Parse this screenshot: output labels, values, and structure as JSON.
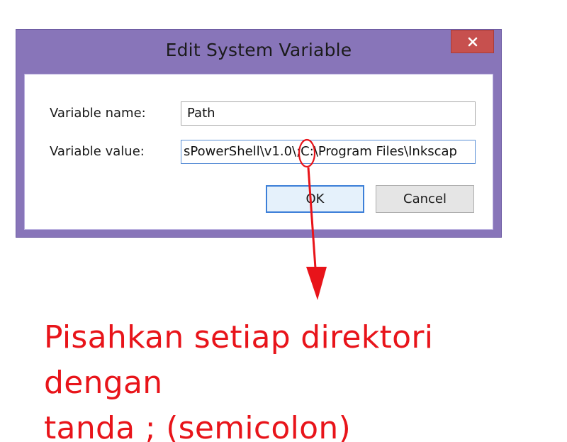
{
  "dialog": {
    "title": "Edit System Variable",
    "variable_name_label": "Variable name:",
    "variable_value_label": "Variable value:",
    "variable_name_value": "Path",
    "variable_value_value": "sPowerShell\\v1.0\\;C:\\Program Files\\Inkscap",
    "ok_label": "OK",
    "cancel_label": "Cancel",
    "close_icon": "close-icon"
  },
  "annotation": {
    "line1": "Pisahkan setiap direktori dengan",
    "line2": "tanda ; (semicolon)",
    "color": "#e8141a"
  },
  "colors": {
    "titlebar": "#8875b9",
    "close_button": "#c7504e",
    "focus_border": "#3c7fd8"
  }
}
